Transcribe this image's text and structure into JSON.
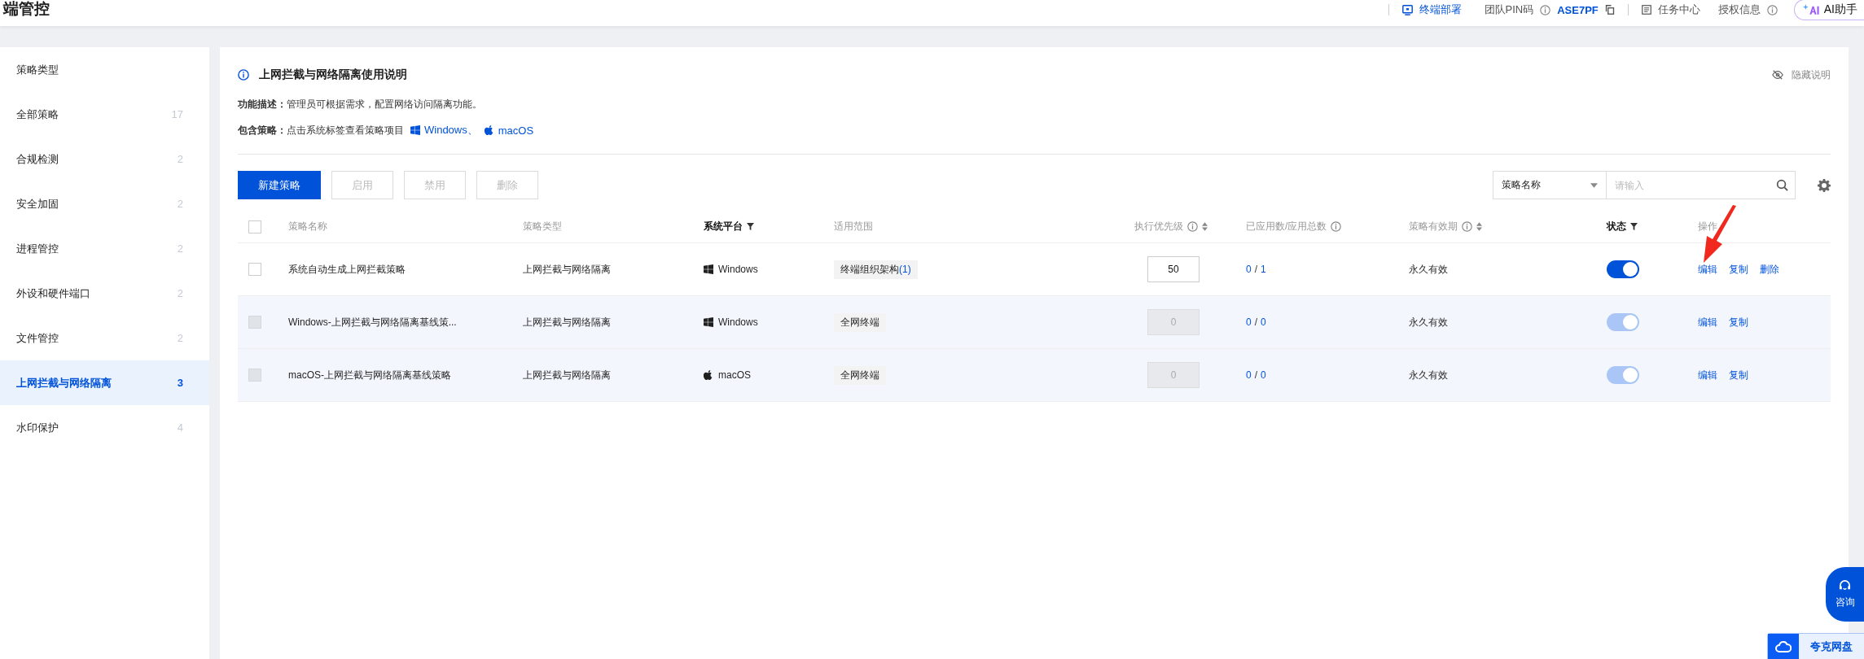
{
  "top_bar": {
    "title": "端管控",
    "deploy_link": "终端部署",
    "pin_label": "团队PIN码",
    "pin_code": "ASE7PF",
    "task_center": "任务中心",
    "license_info": "授权信息",
    "ai_button": "AI助手"
  },
  "sidebar": {
    "heading": "策略类型",
    "items": [
      {
        "label": "全部策略",
        "count": "17",
        "selected": false
      },
      {
        "label": "合规检测",
        "count": "2",
        "selected": false
      },
      {
        "label": "安全加固",
        "count": "2",
        "selected": false
      },
      {
        "label": "进程管控",
        "count": "2",
        "selected": false
      },
      {
        "label": "外设和硬件端口",
        "count": "2",
        "selected": false
      },
      {
        "label": "文件管控",
        "count": "2",
        "selected": false
      },
      {
        "label": "上网拦截与网络隔离",
        "count": "3",
        "selected": true
      },
      {
        "label": "水印保护",
        "count": "4",
        "selected": false
      }
    ]
  },
  "guide": {
    "title": "上网拦截与网络隔离使用说明",
    "hide_link": "隐藏说明",
    "description_label": "功能描述：",
    "description": "管理员可根据需求，配置网络访问隔离功能。",
    "policies_label": "包含策略：",
    "policies_text": "点击系统标签查看策略项目",
    "platform_links": [
      {
        "kind": "windows",
        "label": "Windows、"
      },
      {
        "kind": "apple",
        "label": "macOS"
      }
    ]
  },
  "toolbar": {
    "buttons": [
      {
        "kind": "primary",
        "label": "新建策略",
        "disabled": false
      },
      {
        "kind": "default",
        "label": "启用",
        "disabled": true
      },
      {
        "kind": "default",
        "label": "禁用",
        "disabled": true
      },
      {
        "kind": "default",
        "label": "删除",
        "disabled": true
      }
    ],
    "search_scope": "策略名称",
    "search_placeholder": "请输入"
  },
  "table": {
    "select_all_checked": false,
    "columns": [
      {
        "label": "策略名称",
        "filter": false,
        "info": false,
        "sort": false
      },
      {
        "label": "策略类型",
        "filter": false,
        "info": false,
        "sort": false
      },
      {
        "label": "系统平台",
        "filter": true,
        "info": false,
        "sort": false
      },
      {
        "label": "适用范围",
        "filter": false,
        "info": false,
        "sort": false
      },
      {
        "label": "执行优先级",
        "filter": false,
        "info": true,
        "sort": true
      },
      {
        "label": "已应用数/应用总数",
        "filter": false,
        "info": true,
        "sort": false
      },
      {
        "label": "策略有效期",
        "filter": false,
        "info": true,
        "sort": true
      },
      {
        "label": "状态",
        "filter": true,
        "info": false,
        "sort": false
      },
      {
        "label": "操作",
        "filter": false,
        "info": false,
        "sort": false
      }
    ],
    "rows": [
      {
        "checked": false,
        "disabled": false,
        "name": "系统自动生成上网拦截策略",
        "type": "上网拦截与网络隔离",
        "platform": {
          "kind": "windows",
          "label": "Windows"
        },
        "scope": "终端组织架构",
        "scope_count": "(1)",
        "priority": "50",
        "applied": "0",
        "separator": "/",
        "total": "1",
        "validity": "永久有效",
        "enabled": true,
        "actions": [
          "编辑",
          "复制",
          "删除"
        ]
      },
      {
        "checked": false,
        "disabled": true,
        "name": "Windows-上网拦截与网络隔离基线策...",
        "type": "上网拦截与网络隔离",
        "platform": {
          "kind": "windows",
          "label": "Windows"
        },
        "scope": "全网终端",
        "priority": "0",
        "applied": "0",
        "separator": "/",
        "total": "0",
        "validity": "永久有效",
        "enabled": true,
        "actions": [
          "编辑",
          "复制"
        ]
      },
      {
        "checked": false,
        "disabled": true,
        "name": "macOS-上网拦截与网络隔离基线策略",
        "type": "上网拦截与网络隔离",
        "platform": {
          "kind": "apple",
          "label": "macOS"
        },
        "scope": "全网终端",
        "priority": "0",
        "applied": "0",
        "separator": "/",
        "total": "0",
        "validity": "永久有效",
        "enabled": true,
        "actions": [
          "编辑",
          "复制"
        ]
      }
    ]
  },
  "floating": {
    "consult": "咨询",
    "netdisk": "夸克网盘"
  }
}
